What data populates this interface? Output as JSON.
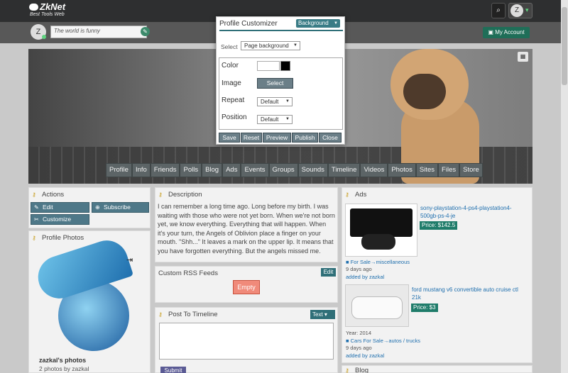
{
  "header": {
    "logo": "ZkNet",
    "tagline": "Best Tools Web",
    "avatar_letter": "Z"
  },
  "status": {
    "avatar_letter": "Z",
    "placeholder": "The world is funny",
    "my_account": "My Account"
  },
  "profile_nav": [
    "Profile",
    "Info",
    "Friends",
    "Polls",
    "Blog",
    "Ads",
    "Events",
    "Groups",
    "Sounds",
    "Timeline",
    "Videos",
    "Photos",
    "Sites",
    "Files",
    "Store"
  ],
  "actions": {
    "title": "Actions",
    "edit": "Edit",
    "subscribe": "Subscribe",
    "customize": "Customize"
  },
  "profile_photos": {
    "title": "Profile Photos",
    "album_title": "zazkal's photos",
    "album_sub": "2 photos by zazkal"
  },
  "description": {
    "title": "Description",
    "text": "I can remember a long time ago. Long before my birth. I was waiting with those who were not yet born. When we're not born yet, we know everything. Everything that will happen. When it's your turn, the Angels of Oblivion place a finger on your mouth. \"Shh...\" It leaves a mark on the upper lip. It means that you have forgotten everything. But the angels missed me."
  },
  "rss": {
    "title": "Custom RSS Feeds",
    "edit": "Edit",
    "empty": "Empty"
  },
  "timeline": {
    "title": "Post To Timeline",
    "type": "Text",
    "submit": "Submit"
  },
  "ads": {
    "title": "Ads",
    "items": [
      {
        "title": "sony-playstation-4-ps4-playstation4-500gb-ps-4-je",
        "price": "Price: $142.5",
        "category": "For Sale→miscellaneous",
        "age": "9 days ago",
        "added_by": "added by zazkal"
      },
      {
        "title": "ford mustang v6 convertible auto cruise ctl 21k",
        "price": "Price: $3",
        "year": "Year: 2014",
        "category": "Cars For Sale→autos / trucks",
        "age": "9 days ago",
        "added_by": "added by zazkal"
      }
    ]
  },
  "blog": {
    "title": "Blog"
  },
  "customizer": {
    "title": "Profile Customizer",
    "mode": "Background",
    "select_label": "Select",
    "target": "Page background",
    "color_label": "Color",
    "image_label": "Image",
    "image_button": "Select",
    "repeat_label": "Repeat",
    "repeat_value": "Default",
    "position_label": "Position",
    "position_value": "Default",
    "buttons": [
      "Save",
      "Reset",
      "Preview",
      "Publish",
      "Close"
    ]
  }
}
